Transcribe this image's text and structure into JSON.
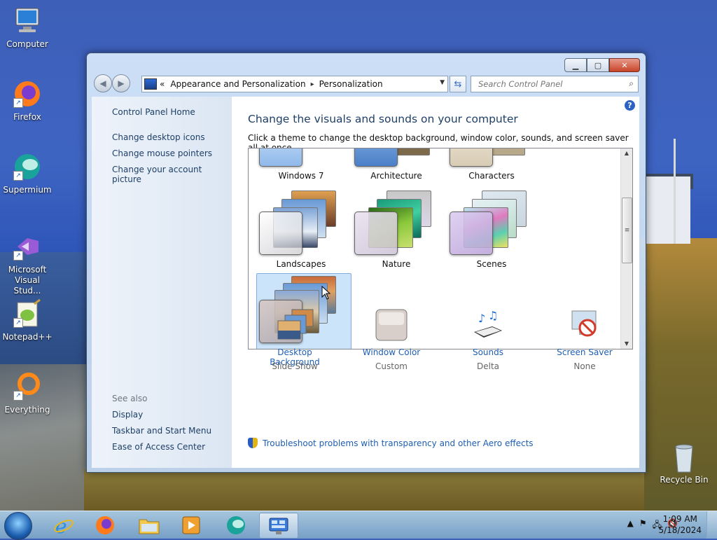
{
  "desktop": {
    "icons": [
      {
        "label": "Computer"
      },
      {
        "label": "Firefox"
      },
      {
        "label": "Supermium"
      },
      {
        "label": "Microsoft Visual Stud..."
      },
      {
        "label": "Notepad++"
      },
      {
        "label": "Everything"
      },
      {
        "label": "Recycle Bin"
      }
    ]
  },
  "window": {
    "breadcrumb": {
      "prefix": "«",
      "items": [
        "Appearance and Personalization",
        "Personalization"
      ],
      "separator": "▸"
    },
    "search": {
      "placeholder": "Search Control Panel"
    },
    "sidebar": {
      "home": "Control Panel Home",
      "links": [
        "Change desktop icons",
        "Change mouse pointers",
        "Change your account picture"
      ],
      "see_also_title": "See also",
      "see_also": [
        "Display",
        "Taskbar and Start Menu",
        "Ease of Access Center"
      ]
    },
    "main": {
      "title": "Change the visuals and sounds on your computer",
      "subtitle": "Click a theme to change the desktop background, window color, sounds, and screen saver all at once.",
      "themes": [
        {
          "label": "Windows 7"
        },
        {
          "label": "Architecture"
        },
        {
          "label": "Characters"
        },
        {
          "label": "Landscapes"
        },
        {
          "label": "Nature"
        },
        {
          "label": "Scenes"
        },
        {
          "label": ""
        }
      ],
      "bottom": [
        {
          "link": "Desktop Background",
          "sub": "Slide Show"
        },
        {
          "link": "Window Color",
          "sub": "Custom"
        },
        {
          "link": "Sounds",
          "sub": "Delta"
        },
        {
          "link": "Screen Saver",
          "sub": "None"
        }
      ],
      "troubleshoot": "Troubleshoot problems with transparency and other Aero effects"
    }
  },
  "taskbar": {
    "clock_time": "1:09 AM",
    "clock_date": "5/18/2024"
  },
  "colors": {
    "link_blue": "#1e5eb3",
    "selected_theme": "#cce4f9",
    "title_blue": "#1e3f66"
  }
}
